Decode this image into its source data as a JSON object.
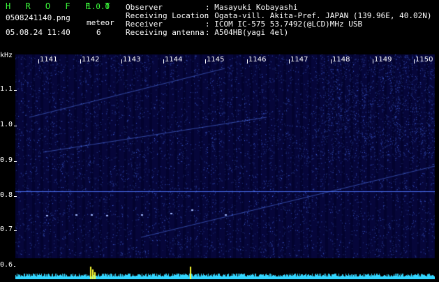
{
  "app": {
    "logo": "H R O F F T",
    "version": "1.0.0",
    "filename": "0508241140.png",
    "datetime": "05.08.24 11:40",
    "meteor_label": "meteor",
    "meteor_count": "6"
  },
  "info": {
    "labels": [
      "Observer",
      "Receiving Location",
      "Receiver",
      "Receiving antenna"
    ],
    "values": [
      ": Masayuki Kobayashi",
      ": Ogata-vill. Akita-Pref. JAPAN (139.96E, 40.02N)",
      ": ICOM IC-575 53.7492(@LCD)MHz USB",
      ": A504HB(yagi 4el)"
    ]
  },
  "axis": {
    "unit": "kHz",
    "y_labels": [
      "1.1",
      "1.0",
      "0.9",
      "0.8",
      "0.7",
      "0.6"
    ],
    "x_labels": [
      "1141",
      "1142",
      "1143",
      "1144",
      "1145",
      "1146",
      "1147",
      "1148",
      "1149",
      "1150"
    ]
  },
  "colors": {
    "header_text": "#3cff3c",
    "background": "#06063a",
    "signal": "#3d6bff",
    "strip": "#33d6ff",
    "burst": "#ffff33"
  }
}
